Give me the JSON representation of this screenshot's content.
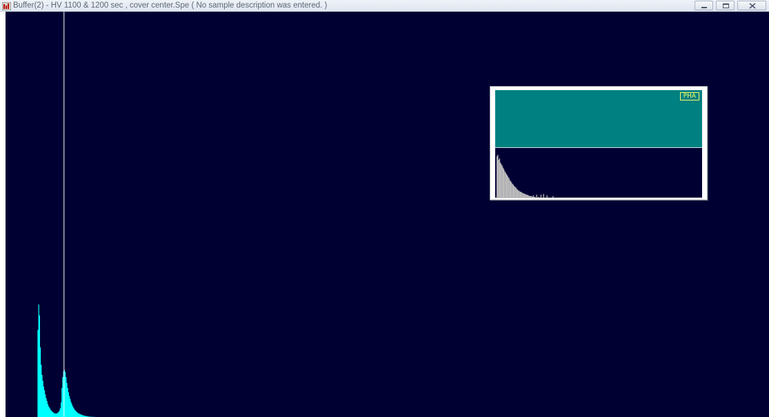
{
  "window": {
    "title": "Buffer(2) - HV 1100 & 1200 sec , cover center.Spe ( No sample description was entered. )",
    "app_icon": "spectrum-app-icon",
    "buttons": {
      "minimize_icon": "minimize-icon",
      "maximize_icon": "maximize-icon",
      "close_icon": "close-icon"
    }
  },
  "overview": {
    "label": "PHA"
  },
  "colors": {
    "plot_background": "#000033",
    "spectrum": "#00ffff",
    "overview_top": "#008080",
    "overview_spectrum": "#c0c0c0",
    "marker": "#ffffff",
    "pha_label": "#ffff66"
  },
  "spectrum": {
    "channels": [
      0,
      0,
      0,
      0,
      0,
      0,
      0,
      0,
      0,
      0,
      0,
      0,
      0,
      0,
      0,
      0,
      0,
      0,
      0,
      0,
      0,
      0,
      120,
      155,
      140,
      96,
      72,
      58,
      50,
      42,
      37,
      31,
      26,
      22,
      18,
      15,
      13,
      11,
      9,
      8,
      7,
      6,
      5,
      5,
      5,
      5,
      6,
      7,
      9,
      12,
      20,
      40,
      55,
      63,
      65,
      62,
      55,
      47,
      40,
      34,
      29,
      25,
      21,
      18,
      15,
      13,
      11,
      9.5,
      8,
      7,
      6,
      5.2,
      4.6,
      4,
      3.5,
      3,
      2.6,
      2.2,
      1.9,
      1.6,
      1.3,
      1.1,
      0.9,
      0.7,
      0.6,
      0.5,
      0.4,
      0.3,
      0.2,
      0.15,
      0.1,
      0.06,
      0.03,
      0,
      0,
      0,
      0,
      0,
      0,
      0
    ],
    "y_max": 165,
    "marker_channel": 54,
    "overview_channels": [
      58,
      60,
      53,
      55,
      49,
      47,
      45,
      42,
      40,
      37,
      35,
      33,
      31,
      29,
      27,
      24,
      23,
      21,
      19,
      18,
      16,
      15,
      14,
      12,
      11,
      10,
      9,
      8,
      8,
      7,
      6,
      6,
      5,
      5,
      4,
      4,
      3,
      3,
      2,
      2,
      2,
      1,
      3,
      1,
      1,
      0,
      4,
      0,
      1,
      0,
      0,
      4,
      0,
      0,
      5,
      0,
      0,
      0,
      3,
      0,
      0,
      0,
      0,
      0,
      0,
      2,
      0,
      0,
      0,
      0,
      0,
      0,
      0,
      0,
      0,
      0,
      0,
      0,
      0,
      0,
      0,
      0,
      0,
      0,
      0,
      0,
      0,
      0,
      0,
      0,
      0,
      0,
      0,
      0,
      0,
      0,
      0,
      0,
      0,
      0
    ],
    "overview_y_max": 62
  }
}
